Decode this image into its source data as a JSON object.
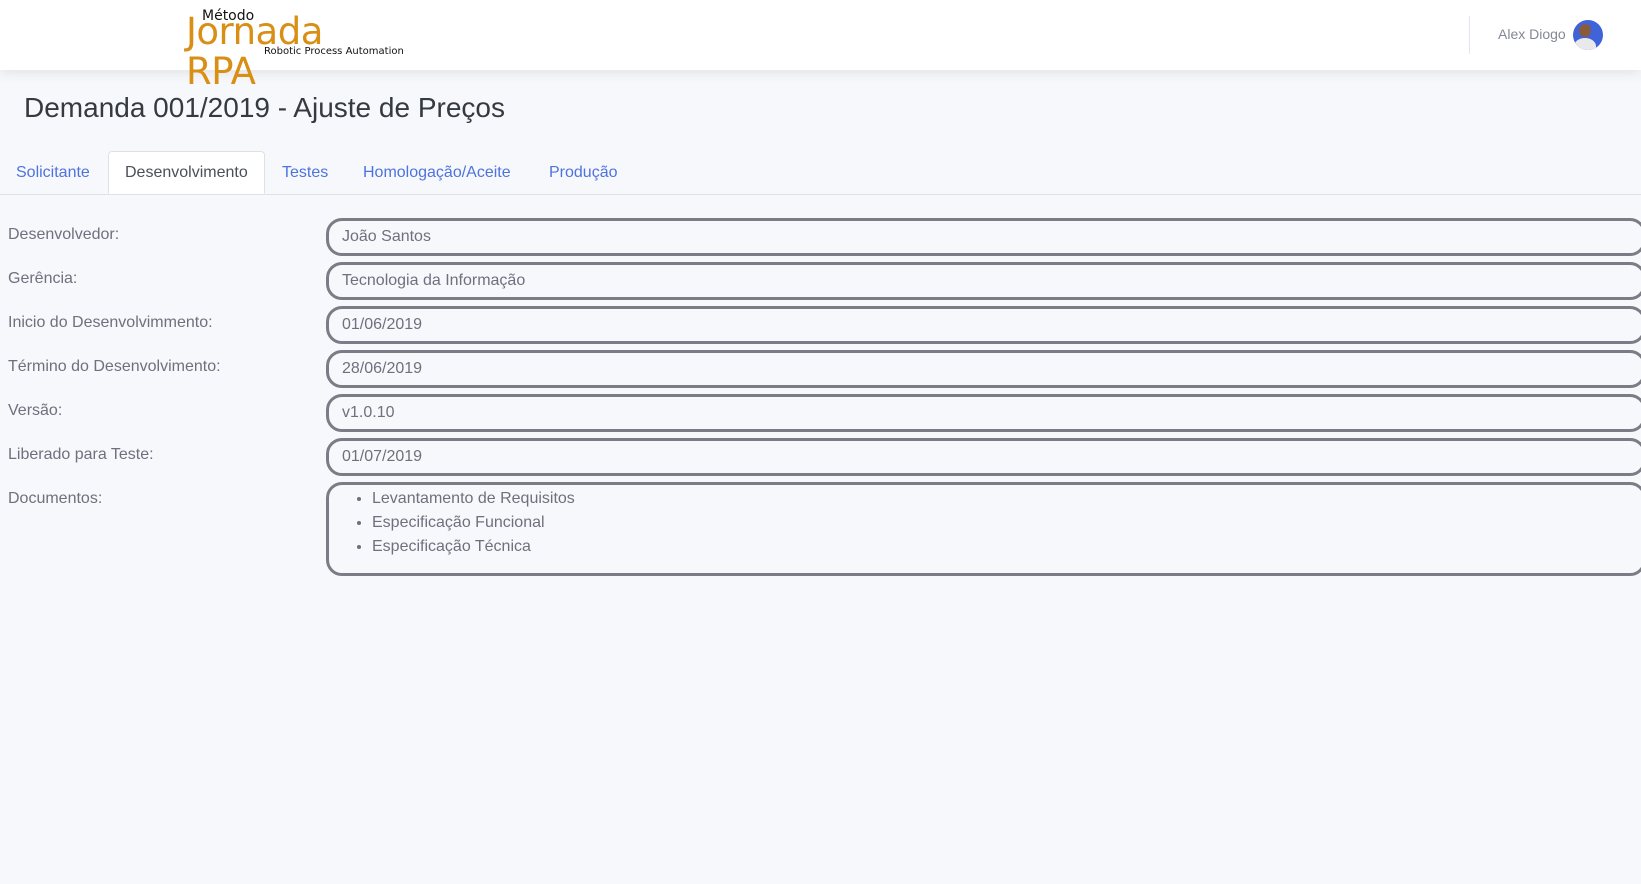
{
  "header": {
    "logo_small": "Método",
    "logo_brand": "Jornada RPA",
    "logo_tagline": "Robotic Process Automation",
    "user_name": "Alex Diogo"
  },
  "page": {
    "title": "Demanda 001/2019 - Ajuste de Preços"
  },
  "tabs": [
    {
      "label": "Solicitante",
      "active": false
    },
    {
      "label": "Desenvolvimento",
      "active": true
    },
    {
      "label": "Testes",
      "active": false
    },
    {
      "label": "Homologação/Aceite",
      "active": false
    },
    {
      "label": "Produção",
      "active": false
    }
  ],
  "form": {
    "fields": [
      {
        "label": "Desenvolvedor:",
        "value": "João Santos"
      },
      {
        "label": "Gerência:",
        "value": "Tecnologia da Informação"
      },
      {
        "label": "Inicio do Desenvolvimmento:",
        "value": "01/06/2019"
      },
      {
        "label": "Término do Desenvolvimento:",
        "value": "28/06/2019"
      },
      {
        "label": "Versão:",
        "value": "v1.0.10"
      },
      {
        "label": "Liberado para Teste:",
        "value": "01/07/2019"
      }
    ],
    "documents": {
      "label": "Documentos:",
      "items": [
        "Levantamento de Requisitos",
        "Especificação Funcional",
        "Especificação Técnica"
      ]
    }
  },
  "colors": {
    "brand_orange": "#d98e14",
    "link_blue": "#4e73df",
    "field_border": "#7b7c86",
    "background": "#f7f8fb"
  }
}
